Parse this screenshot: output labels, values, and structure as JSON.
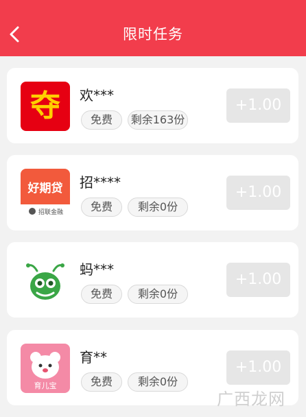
{
  "header": {
    "title": "限时任务",
    "back_icon": "chevron-left-icon",
    "bg_color": "#f23d4c"
  },
  "tasks": [
    {
      "name": "欢***",
      "icon_text": "夺",
      "icon_color": "#e60012",
      "tag_free": "免费",
      "tag_remaining": "剩余163份",
      "reward": "+1.00"
    },
    {
      "name": "招****",
      "icon_text": "好期贷",
      "icon_subtext": "招联金融",
      "icon_color": "#f25a3c",
      "tag_free": "免费",
      "tag_remaining": "剩余0份",
      "reward": "+1.00"
    },
    {
      "name": "蚂***",
      "icon_text": "",
      "icon_color": "#3aa646",
      "tag_free": "免费",
      "tag_remaining": "剩余0份",
      "reward": "+1.00"
    },
    {
      "name": "育**",
      "icon_text": "育儿宝",
      "icon_color": "#f7b1c2",
      "tag_free": "免费",
      "tag_remaining": "剩余0份",
      "reward": "+1.00"
    }
  ],
  "watermark": "广西龙网"
}
